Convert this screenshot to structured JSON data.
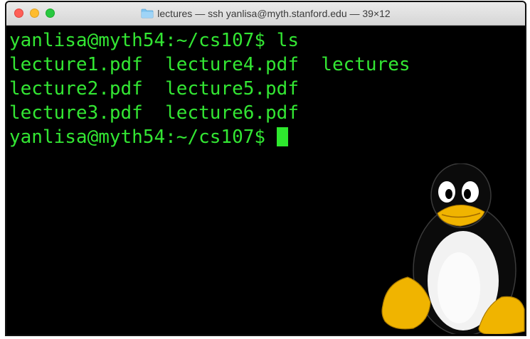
{
  "window": {
    "title": "lectures — ssh yanlisa@myth.stanford.edu — 39×12",
    "folder_icon": "folder-icon"
  },
  "terminal": {
    "prompt": "yanlisa@myth54:~/cs107$",
    "command": "ls",
    "files_row1": "lecture1.pdf  lecture4.pdf  lectures",
    "files_row2": "lecture2.pdf  lecture5.pdf",
    "files_row3": "lecture3.pdf  lecture6.pdf",
    "text_color": "#33e633",
    "background": "#000000"
  },
  "decoration": {
    "mascot": "tux-penguin-icon"
  }
}
